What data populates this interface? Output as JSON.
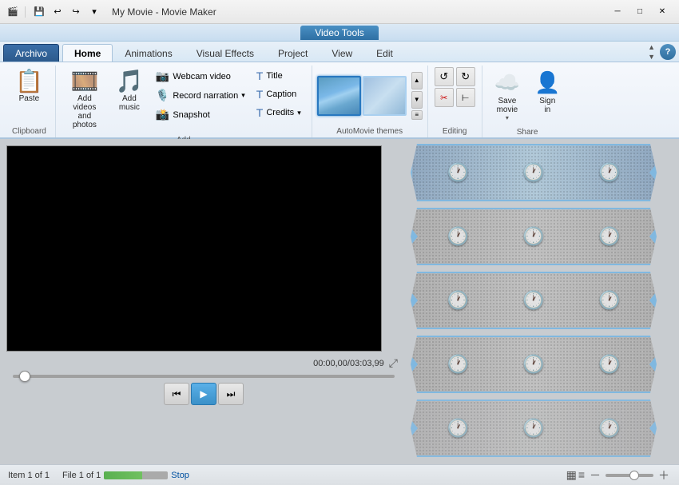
{
  "titleBar": {
    "appTitle": "My Movie - Movie Maker",
    "minimizeLabel": "─",
    "maximizeLabel": "□",
    "closeLabel": "✕"
  },
  "videoToolsBar": {
    "label": "Video Tools"
  },
  "ribbonTabs": {
    "archivo": "Archivo",
    "home": "Home",
    "animations": "Animations",
    "visualEffects": "Visual Effects",
    "project": "Project",
    "view": "View",
    "edit": "Edit"
  },
  "clipboard": {
    "paste": "Paste",
    "label": "Clipboard"
  },
  "addGroup": {
    "addVideos": "Add videos\nand photos",
    "addMusic": "Add\nmusic",
    "webcamVideo": "Webcam video",
    "recordNarration": "Record narration",
    "snapshot": "Snapshot",
    "title": "Title",
    "caption": "Caption",
    "credits": "Credits",
    "label": "Add"
  },
  "autoMovieGroup": {
    "label": "AutoMovie themes"
  },
  "editingGroup": {
    "label": "Editing"
  },
  "shareGroup": {
    "saveMovie": "Save\nmovie",
    "signIn": "Sign\nin",
    "label": "Share"
  },
  "preview": {
    "timeCode": "00:00,00/03:03,99"
  },
  "statusBar": {
    "item1": "Item 1 of 1",
    "file1": "File 1 of 1",
    "stop": "Stop"
  }
}
